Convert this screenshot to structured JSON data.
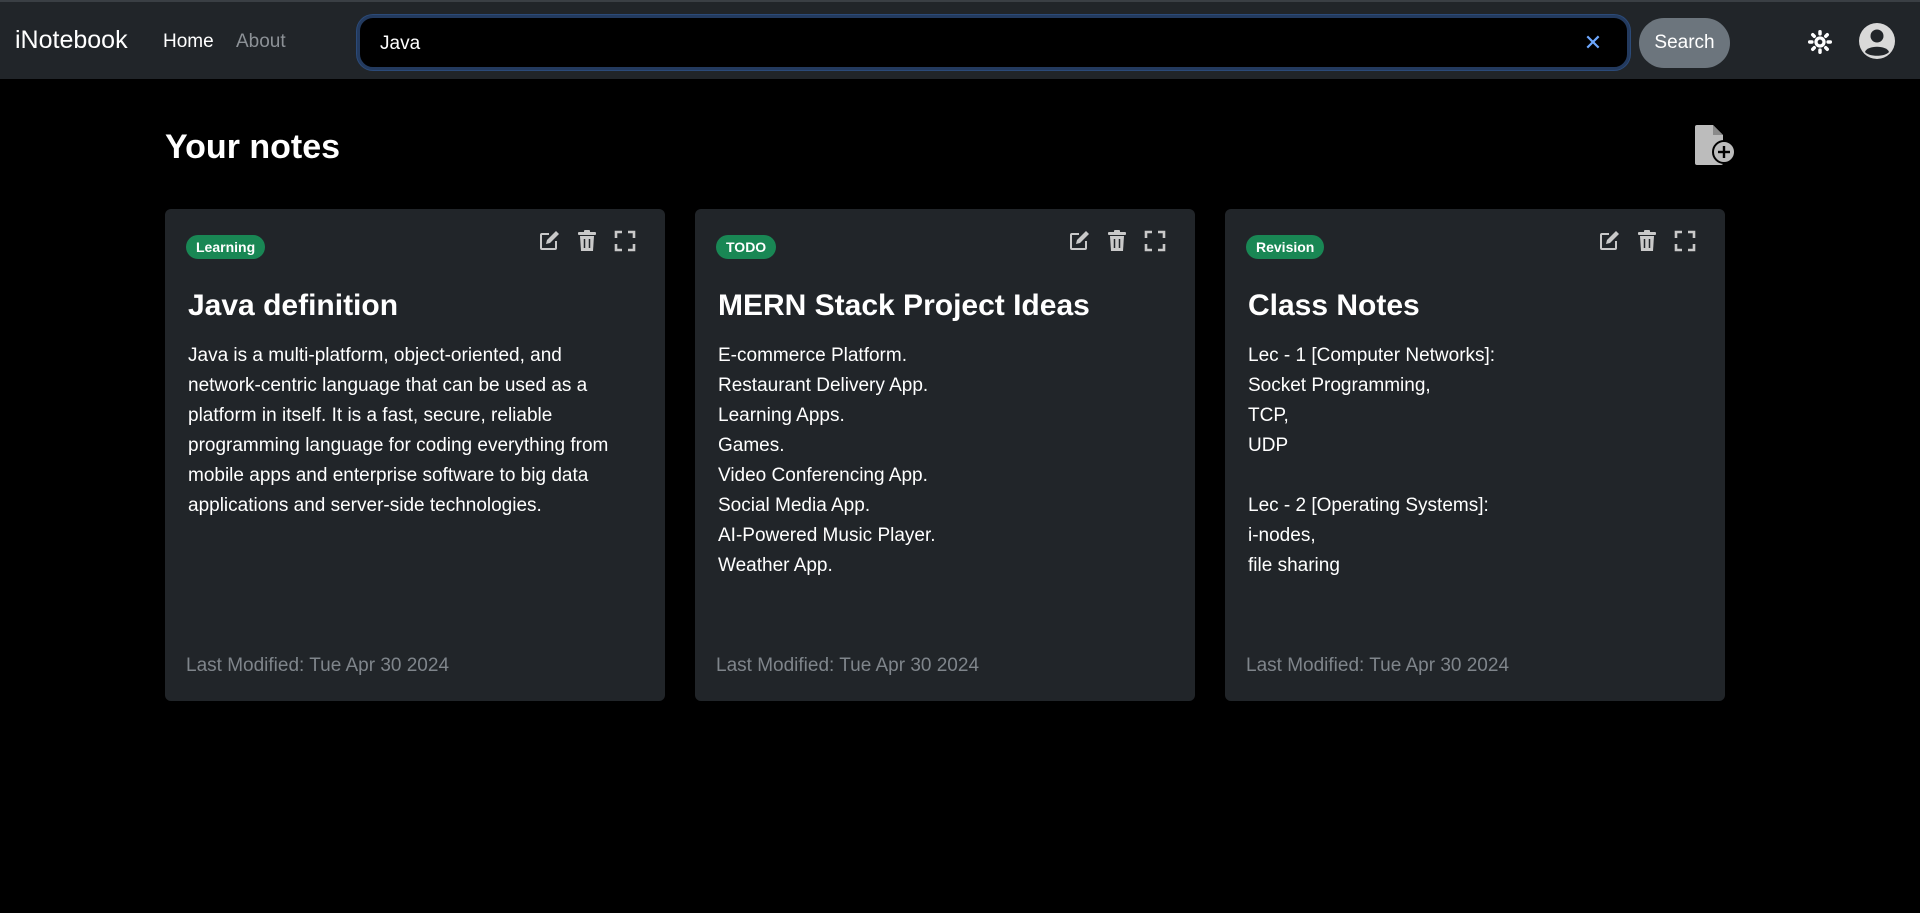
{
  "navbar": {
    "brand": "iNotebook",
    "links": [
      "Home",
      "About"
    ],
    "search": {
      "value": "Java",
      "placeholder": "Search",
      "button_label": "Search",
      "clear_symbol": "✕"
    },
    "icons": [
      "theme-toggle-icon",
      "user-avatar-icon"
    ]
  },
  "page": {
    "title": "Your notes",
    "add_note_icon": "add-note-icon"
  },
  "notes": [
    {
      "tag": "Learning",
      "title": "Java definition",
      "lines": [
        "Java is a multi-platform, object-oriented, and",
        "network-centric language that can be used as a",
        "platform in itself. It is a fast, secure, reliable",
        "programming language for coding everything from",
        "mobile apps and enterprise software to big data",
        "applications and server-side technologies."
      ],
      "footer": "Last Modified: Tue Apr 30 2024"
    },
    {
      "tag": "TODO",
      "title": "MERN Stack Project Ideas",
      "lines": [
        "E-commerce Platform.",
        "Restaurant Delivery App.",
        "Learning Apps.",
        "Games.",
        "Video Conferencing App.",
        "Social Media App.",
        "AI-Powered Music Player.",
        "Weather App."
      ],
      "footer": "Last Modified: Tue Apr 30 2024"
    },
    {
      "tag": "Revision",
      "title": "Class Notes",
      "lines": [
        "Lec - 1 [Computer Networks]:",
        "Socket Programming,",
        "TCP,",
        "UDP",
        "",
        "Lec - 2 [Operating Systems]:",
        "i-nodes,",
        "file sharing"
      ],
      "footer": "Last Modified: Tue Apr 30 2024"
    }
  ],
  "colors": {
    "navbar_bg": "#212529",
    "page_bg": "#000000",
    "card_bg": "#212529",
    "badge_bg": "#198754",
    "search_button_bg": "#6c757d",
    "muted_text": "#7f858b"
  }
}
